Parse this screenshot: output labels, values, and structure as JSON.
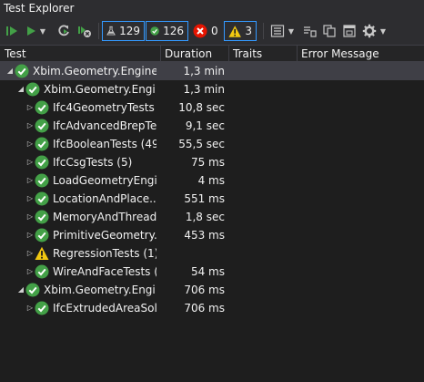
{
  "window": {
    "title": "Test Explorer"
  },
  "toolbar": {
    "total_count": "129",
    "passed_count": "126",
    "failed_count": "0",
    "warning_count": "3"
  },
  "columns": {
    "test": "Test",
    "duration": "Duration",
    "traits": "Traits",
    "error_message": "Error Message"
  },
  "colors": {
    "passed": "#43a047",
    "warning": "#f2c811",
    "failed": "#e51400",
    "accent": "#3399ff"
  },
  "tree": [
    {
      "name": "Xbim.Geometry.Engine...",
      "duration": "1,3 min",
      "status": "passed",
      "level": 0,
      "expanded": true,
      "selected": true
    },
    {
      "name": "Xbim.Geometry.Engi...",
      "duration": "1,3 min",
      "status": "passed",
      "level": 1,
      "expanded": true
    },
    {
      "name": "Ifc4GeometryTests (...",
      "duration": "10,8 sec",
      "status": "passed",
      "level": 2,
      "expanded": false
    },
    {
      "name": "IfcAdvancedBrepTe...",
      "duration": "9,1 sec",
      "status": "passed",
      "level": 2,
      "expanded": false
    },
    {
      "name": "IfcBooleanTests (49)",
      "duration": "55,5 sec",
      "status": "passed",
      "level": 2,
      "expanded": false
    },
    {
      "name": "IfcCsgTests (5)",
      "duration": "75 ms",
      "status": "passed",
      "level": 2,
      "expanded": false
    },
    {
      "name": "LoadGeometryEngi...",
      "duration": "4 ms",
      "status": "passed",
      "level": 2,
      "expanded": false
    },
    {
      "name": "LocationAndPlace... .",
      "duration": "551 ms",
      "status": "passed",
      "level": 2,
      "expanded": false
    },
    {
      "name": "MemoryAndThread...",
      "duration": "1,8 sec",
      "status": "passed",
      "level": 2,
      "expanded": false
    },
    {
      "name": "PrimitiveGeometry...",
      "duration": "453 ms",
      "status": "passed",
      "level": 2,
      "expanded": false
    },
    {
      "name": "RegressionTests (1)",
      "duration": "",
      "status": "warning",
      "level": 2,
      "expanded": false
    },
    {
      "name": "WireAndFaceTests (...",
      "duration": "54 ms",
      "status": "passed",
      "level": 2,
      "expanded": false
    },
    {
      "name": "Xbim.Geometry.Engi...",
      "duration": "706 ms",
      "status": "passed",
      "level": 1,
      "expanded": true
    },
    {
      "name": "IfcExtrudedAreaSoli...",
      "duration": "706 ms",
      "status": "passed",
      "level": 2,
      "expanded": false
    }
  ]
}
